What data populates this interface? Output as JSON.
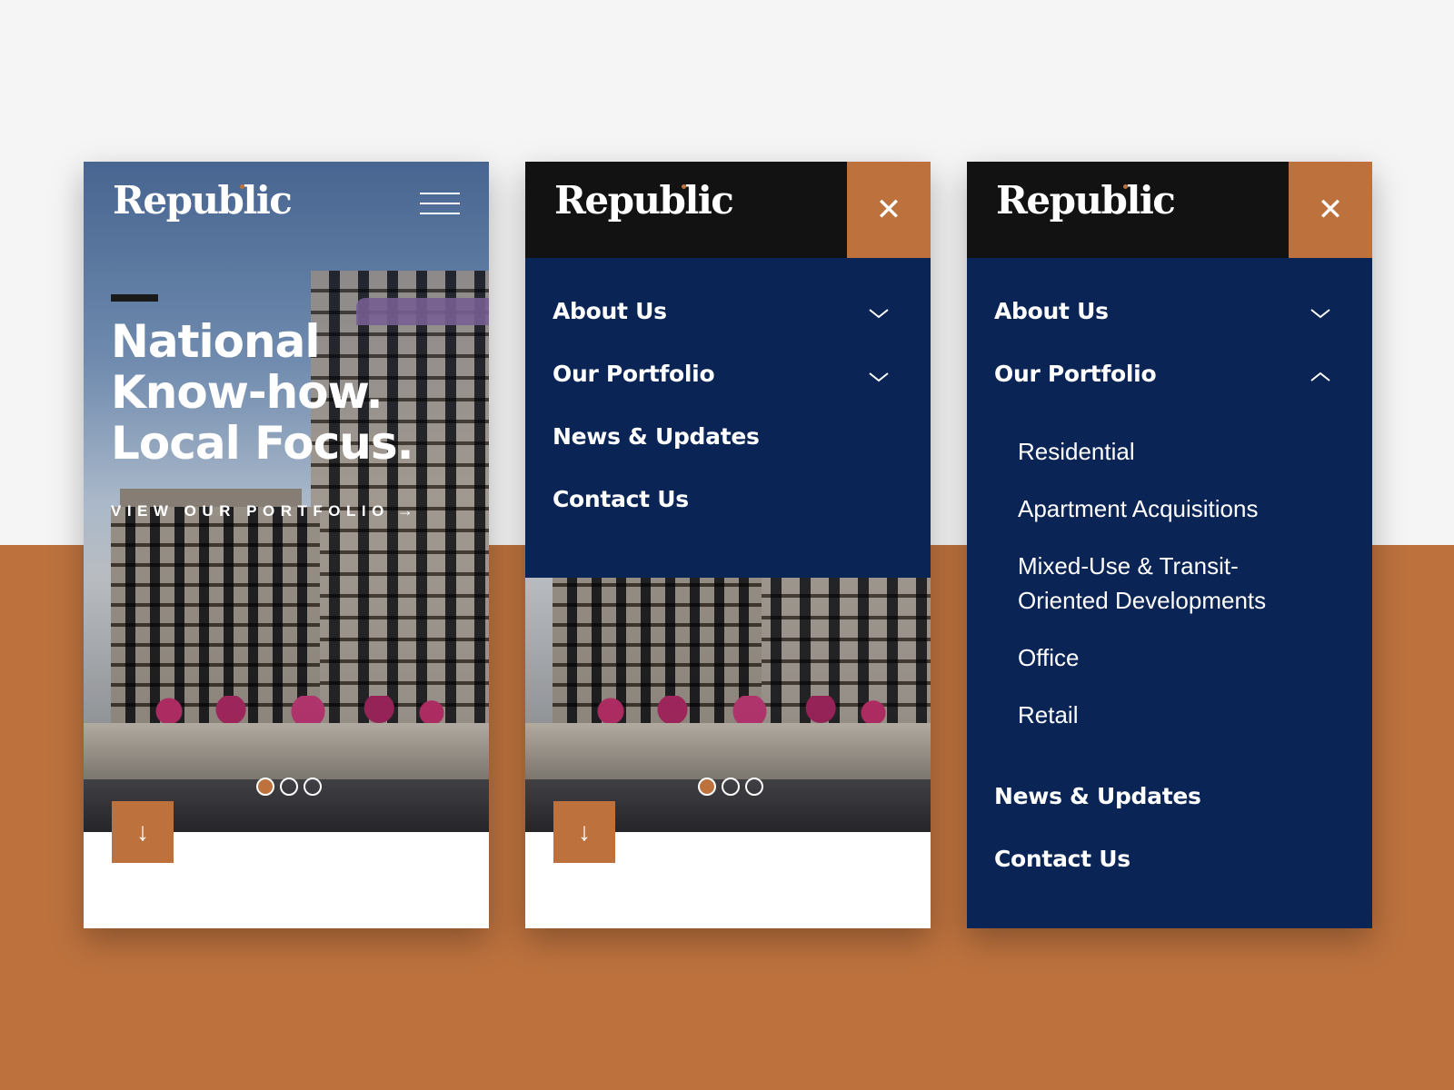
{
  "brand": {
    "name": "Republic",
    "accent": "#bd723e",
    "navy": "#0a2456",
    "dark": "#121212"
  },
  "home": {
    "menu_icon": "hamburger-icon",
    "headline": [
      "National",
      "Know-how.",
      "Local Focus."
    ],
    "cta_label": "VIEW OUR PORTFOLIO",
    "cta_arrow": "→",
    "scroll_down": "↓",
    "carousel": {
      "slides": 3,
      "active": 1
    }
  },
  "menu": {
    "close_symbol": "✕",
    "items": [
      "About Us",
      "Our Portfolio",
      "News & Updates",
      "Contact Us"
    ]
  },
  "expanded": {
    "submenu": [
      "Residential",
      "Apartment Acquisitions",
      "Mixed-Use & Transit-",
      "Oriented Developments",
      "Office",
      "Retail"
    ]
  }
}
